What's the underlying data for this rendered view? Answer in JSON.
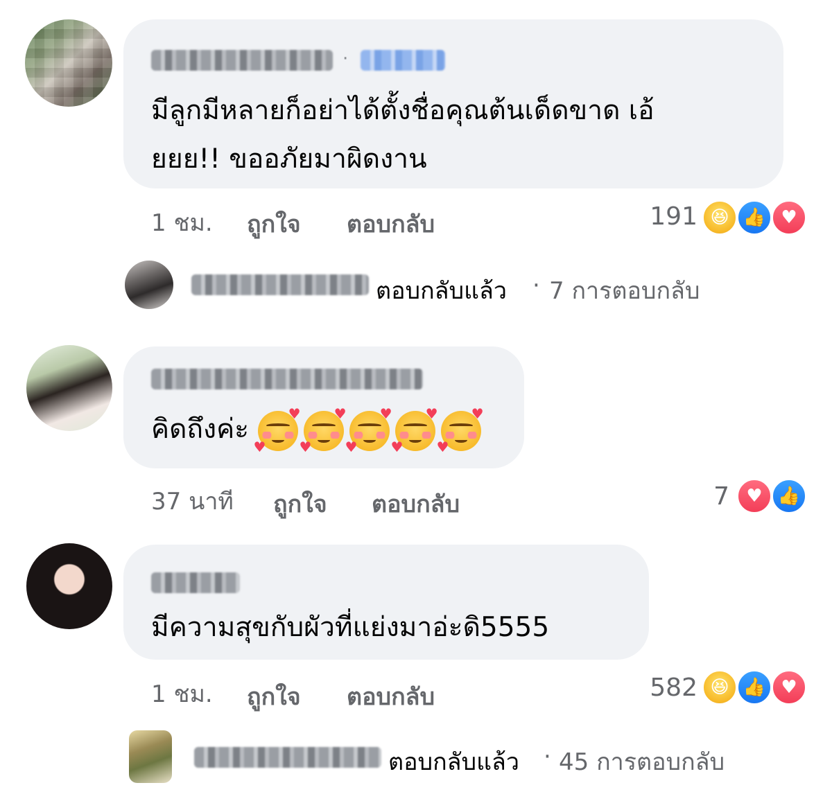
{
  "comments": [
    {
      "text_line1": "มีลูกมีหลายก็อย่าได้ตั้งชื่อคุณต้นเด็ดขาด เอ้",
      "text_line2": "ยยย!! ขออภัยมาผิดงาน",
      "time": "1 ชม.",
      "like_label": "ถูกใจ",
      "reply_label": "ตอบกลับ",
      "reaction_count": "191",
      "reactions": [
        "haha-icon",
        "like-icon",
        "love-icon"
      ],
      "replies_summary": {
        "label": "ตอบกลับแล้ว",
        "separator": "·",
        "count_text": "7 การตอบกลับ"
      }
    },
    {
      "text": "คิดถึงค่ะ",
      "emoji_count": 5,
      "time": "37 นาที",
      "like_label": "ถูกใจ",
      "reply_label": "ตอบกลับ",
      "reaction_count": "7",
      "reactions": [
        "love-icon",
        "like-icon"
      ]
    },
    {
      "text": "มีความสุขกับผัวที่แย่งมาอ่ะดิ5555",
      "time": "1 ชม.",
      "like_label": "ถูกใจ",
      "reply_label": "ตอบกลับ",
      "reaction_count": "582",
      "reactions": [
        "haha-icon",
        "like-icon",
        "love-icon"
      ],
      "replies_summary": {
        "label": "ตอบกลับแล้ว",
        "separator": "·",
        "count_text": "45 การตอบกลับ"
      }
    }
  ],
  "colors": {
    "bubble": "#f0f2f5",
    "meta_text": "#65676b",
    "like_blue": "#1877f2",
    "love_red": "#f33e58",
    "haha_yellow": "#f7b928"
  }
}
